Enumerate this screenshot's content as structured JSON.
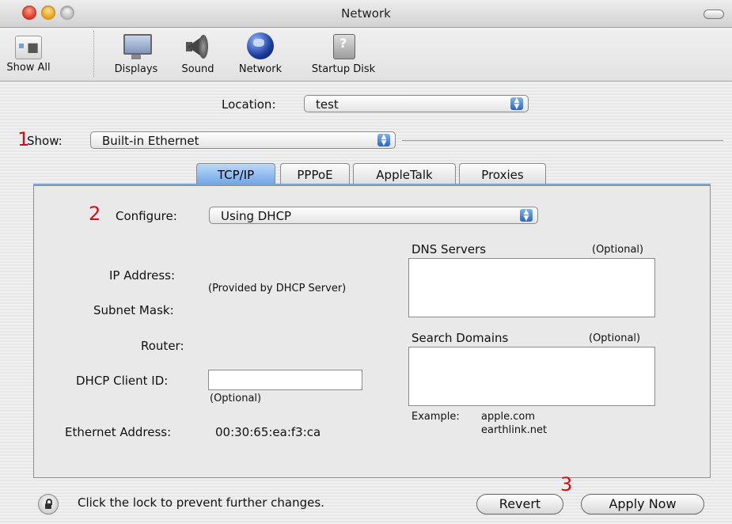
{
  "window": {
    "title": "Network"
  },
  "toolbar": {
    "items": [
      {
        "label": "Show All",
        "icon": "show-all-icon"
      },
      {
        "label": "Displays",
        "icon": "displays-icon"
      },
      {
        "label": "Sound",
        "icon": "sound-icon"
      },
      {
        "label": "Network",
        "icon": "network-globe-icon"
      },
      {
        "label": "Startup Disk",
        "icon": "startup-disk-icon"
      }
    ]
  },
  "location": {
    "label": "Location:",
    "value": "test"
  },
  "show": {
    "marker": "1",
    "label": "Show:",
    "value": "Built-in Ethernet"
  },
  "tabs": [
    {
      "label": "TCP/IP",
      "active": true
    },
    {
      "label": "PPPoE",
      "active": false
    },
    {
      "label": "AppleTalk",
      "active": false
    },
    {
      "label": "Proxies",
      "active": false
    }
  ],
  "tcpip": {
    "configure_marker": "2",
    "configure_label": "Configure:",
    "configure_value": "Using DHCP",
    "ip_label": "IP Address:",
    "ip_value": "(Provided by DHCP Server)",
    "subnet_label": "Subnet Mask:",
    "router_label": "Router:",
    "client_id_label": "DHCP Client ID:",
    "client_id_value": "",
    "client_id_hint": "(Optional)",
    "ethernet_label": "Ethernet Address:",
    "ethernet_value": "00:30:65:ea:f3:ca",
    "dns_label": "DNS Servers",
    "dns_optional": "(Optional)",
    "search_label": "Search Domains",
    "search_optional": "(Optional)",
    "example_label": "Example:",
    "example_line1": "apple.com",
    "example_line2": "earthlink.net"
  },
  "footer": {
    "lock_text": "Click the lock to prevent further changes.",
    "marker": "3",
    "revert_label": "Revert",
    "apply_label": "Apply Now"
  },
  "colors": {
    "accent": "#5b95e0",
    "marker": "#d01010"
  }
}
